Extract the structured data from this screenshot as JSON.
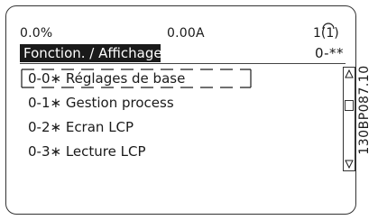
{
  "status_bar": {
    "left": "0.0%",
    "center": "0.00A",
    "setup": "1(1)"
  },
  "header": {
    "title": "Fonction. / Affichage",
    "value": "0-**"
  },
  "menu": {
    "items": [
      {
        "label": "0-0∗ Réglages de base",
        "selected": true
      },
      {
        "label": "0-1∗ Gestion process",
        "selected": false
      },
      {
        "label": "0-2∗ Ecran LCP",
        "selected": false
      },
      {
        "label": "0-3∗ Lecture LCP",
        "selected": false
      }
    ]
  },
  "scrollbar": {
    "up_icon": "triangle-up-icon",
    "down_icon": "triangle-down-icon"
  },
  "figure_ref": "130BP087.10",
  "colors": {
    "header_bg": "#1a1a1a",
    "header_fg": "#ffffff",
    "text": "#1a1a1a"
  }
}
